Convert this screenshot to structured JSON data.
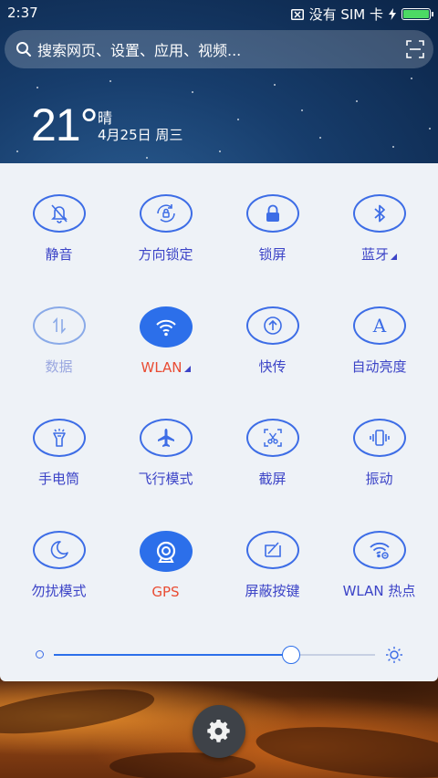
{
  "status_bar": {
    "time": "2:37",
    "carrier": "没有 SIM 卡",
    "battery_level": 1.0
  },
  "search": {
    "placeholder": "搜索网页、设置、应用、视频..."
  },
  "weather": {
    "temperature": "21°",
    "condition": "晴",
    "date": "4月25日 周三"
  },
  "toggles": [
    {
      "label": "静音",
      "icon": "mute-bell-icon",
      "state": "off"
    },
    {
      "label": "方向锁定",
      "icon": "rotation-lock-icon",
      "state": "off"
    },
    {
      "label": "锁屏",
      "icon": "lock-icon",
      "state": "off"
    },
    {
      "label": "蓝牙",
      "icon": "bluetooth-icon",
      "state": "off",
      "has_submenu": true
    },
    {
      "label": "数据",
      "icon": "mobile-data-icon",
      "state": "disabled"
    },
    {
      "label": "WLAN",
      "icon": "wifi-icon",
      "state": "on",
      "has_submenu": true
    },
    {
      "label": "快传",
      "icon": "quick-transfer-icon",
      "state": "off"
    },
    {
      "label": "自动亮度",
      "icon": "auto-brightness-icon",
      "state": "off"
    },
    {
      "label": "手电筒",
      "icon": "flashlight-icon",
      "state": "off"
    },
    {
      "label": "飞行模式",
      "icon": "airplane-icon",
      "state": "off"
    },
    {
      "label": "截屏",
      "icon": "screenshot-scissors-icon",
      "state": "off"
    },
    {
      "label": "振动",
      "icon": "vibrate-icon",
      "state": "off"
    },
    {
      "label": "勿扰模式",
      "icon": "moon-icon",
      "state": "off"
    },
    {
      "label": "GPS",
      "icon": "gps-icon",
      "state": "on"
    },
    {
      "label": "屏蔽按键",
      "icon": "block-keys-icon",
      "state": "off"
    },
    {
      "label": "WLAN 热点",
      "icon": "hotspot-icon",
      "state": "off"
    }
  ],
  "brightness": {
    "level": 0.74
  },
  "colors": {
    "accent": "#2c6fea",
    "label": "#3c44c7",
    "active_label": "#e94c33",
    "panel_bg": "#eef2f7"
  }
}
